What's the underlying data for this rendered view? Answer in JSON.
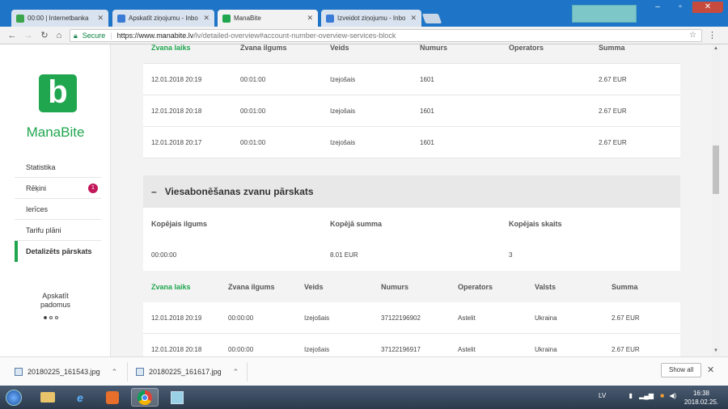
{
  "browser": {
    "tabs": [
      {
        "label": "00:00 | Internetbanka",
        "active": false,
        "favicon_color": "#3aa54a"
      },
      {
        "label": "Apskatīt ziņojumu - Inbo",
        "active": false,
        "favicon_color": "#3a7bd5"
      },
      {
        "label": "ManaBite",
        "active": true,
        "favicon_color": "#1fa64e"
      },
      {
        "label": "Izveidot ziņojumu - Inbo",
        "active": false,
        "favicon_color": "#3a7bd5"
      }
    ],
    "secure_label": "Secure",
    "url_host": "https://www.manabite.lv",
    "url_path": "/lv/detailed-overview#account-number-overview-services-block"
  },
  "sidebar": {
    "brand": "ManaBite",
    "logo_letter": "b",
    "items": [
      {
        "label": "Statistika"
      },
      {
        "label": "Rēķini",
        "badge": "1"
      },
      {
        "label": "Ierīces"
      },
      {
        "label": "Tarifu plāni"
      },
      {
        "label": "Detalizēts pārskats",
        "active": true
      }
    ],
    "tips_line1": "Apskatīt",
    "tips_line2": "padomus"
  },
  "calls_table": {
    "headers": [
      "Zvana laiks",
      "Zvana ilgums",
      "Veids",
      "Numurs",
      "Operators",
      "Summa"
    ],
    "rows": [
      [
        "12.01.2018 20:19",
        "00:01:00",
        "Izejošais",
        "1601",
        "",
        "2.67 EUR"
      ],
      [
        "12.01.2018 20:18",
        "00:01:00",
        "Izejošais",
        "1601",
        "",
        "2.67 EUR"
      ],
      [
        "12.01.2018 20:17",
        "00:01:00",
        "Izejošais",
        "1601",
        "",
        "2.67 EUR"
      ]
    ]
  },
  "roaming_section": {
    "toggle": "–",
    "title": "Viesabonēšanas zvanu pārskats",
    "summary_headers": [
      "Kopējais ilgums",
      "Kopējā summa",
      "Kopējais skaits"
    ],
    "summary_values": [
      "00:00:00",
      "8.01 EUR",
      "3"
    ],
    "headers": [
      "Zvana laiks",
      "Zvana ilgums",
      "Veids",
      "Numurs",
      "Operators",
      "Valsts",
      "Summa"
    ],
    "rows": [
      [
        "12.01.2018 20:19",
        "00:00:00",
        "Izejošais",
        "37122196902",
        "Astelit",
        "Ukraina",
        "2.67 EUR"
      ],
      [
        "12.01.2018 20:18",
        "00:00:00",
        "Izejošais",
        "37122196917",
        "Astelit",
        "Ukraina",
        "2.67 EUR"
      ]
    ]
  },
  "downloads": {
    "items": [
      {
        "name": "20180225_161543.jpg"
      },
      {
        "name": "20180225_161617.jpg"
      }
    ],
    "show_all": "Show all"
  },
  "taskbar": {
    "lang": "LV",
    "time": "16:38",
    "date": "2018.02.25."
  },
  "colors": {
    "brand_green": "#1fa64e",
    "badge": "#c2185b"
  }
}
